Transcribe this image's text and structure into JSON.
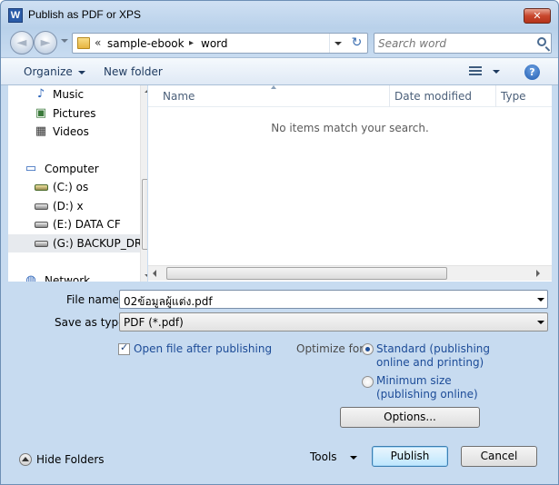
{
  "window": {
    "app_icon_letter": "W",
    "title": "Publish as PDF or XPS",
    "close_glyph": "✕"
  },
  "nav": {
    "back_glyph": "◄",
    "forward_glyph": "►",
    "breadcrumb_chevron": "«",
    "breadcrumb": [
      "sample-ebook",
      "word"
    ],
    "breadcrumb_sep": "▸",
    "refresh_glyph": "↻",
    "search_placeholder": "Search word"
  },
  "toolbar": {
    "organize_label": "Organize",
    "new_folder_label": "New folder",
    "help_glyph": "?"
  },
  "sidebar": {
    "items": [
      {
        "label": "Music",
        "icon": "music-icon",
        "glyph": "♪",
        "icon_color": "#2b63b8"
      },
      {
        "label": "Pictures",
        "icon": "pictures-icon",
        "glyph": "▣",
        "icon_color": "#3b7a3b"
      },
      {
        "label": "Videos",
        "icon": "videos-icon",
        "glyph": "▦",
        "icon_color": "#333333"
      },
      {
        "label": "Computer",
        "icon": "computer-icon",
        "glyph": "▭",
        "icon_color": "#2b63b8"
      },
      {
        "label": "(C:) os",
        "icon": "system-drive-icon"
      },
      {
        "label": "(D:) x",
        "icon": "drive-icon"
      },
      {
        "label": "(E:) DATA CF",
        "icon": "drive-icon"
      },
      {
        "label": "(G:) BACKUP_DRV",
        "icon": "drive-icon",
        "selected": true
      },
      {
        "label": "Network",
        "icon": "network-icon",
        "glyph": "◍",
        "icon_color": "#2b63b8"
      }
    ]
  },
  "file_list": {
    "columns": [
      "Name",
      "Date modified",
      "Type"
    ],
    "empty_message": "No items match your search."
  },
  "form": {
    "file_name_label": "File name:",
    "file_name_value": "02ข้อมูลผู้แต่ง.pdf",
    "save_as_type_label": "Save as type:",
    "save_as_type_value": "PDF (*.pdf)",
    "open_after_label": "Open file after publishing",
    "open_after_checked": true,
    "optimize_label": "Optimize for:",
    "standard_line1": "Standard (publishing",
    "standard_line2": "online and printing)",
    "minimum_line1": "Minimum size",
    "minimum_line2": "(publishing online)",
    "selected_optimize": "standard",
    "options_button": "Options..."
  },
  "footer": {
    "hide_folders_label": "Hide Folders",
    "tools_label": "Tools",
    "publish_button": "Publish",
    "cancel_button": "Cancel"
  }
}
